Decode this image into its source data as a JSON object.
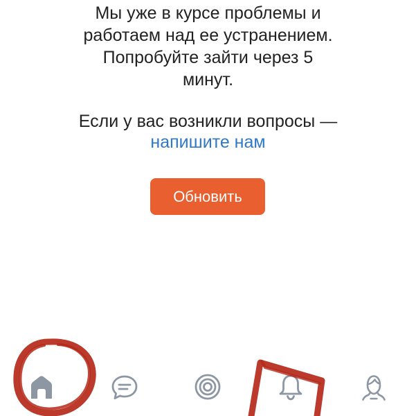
{
  "message": {
    "line1": "Мы уже в курсе проблемы и",
    "line2": "работаем над ее устранением.",
    "line3": "Попробуйте зайти через 5",
    "line4": "минут.",
    "contact_prefix": "Если у вас возникли вопросы —",
    "contact_link": "напишите нам"
  },
  "refresh_button": {
    "label": "Обновить"
  },
  "tabbar": {
    "tabs": [
      {
        "icon": "home-icon",
        "active": true
      },
      {
        "icon": "chat-bubble-icon",
        "active": false
      },
      {
        "icon": "target-icon",
        "active": false
      },
      {
        "icon": "bell-icon",
        "active": false
      },
      {
        "icon": "profile-icon",
        "active": false
      }
    ]
  },
  "annotations": {
    "markup_color": "#b5291a"
  },
  "colors": {
    "accent": "#ea5f2f",
    "link": "#2f79c8",
    "text": "#222222",
    "icon": "#8c97a3"
  }
}
